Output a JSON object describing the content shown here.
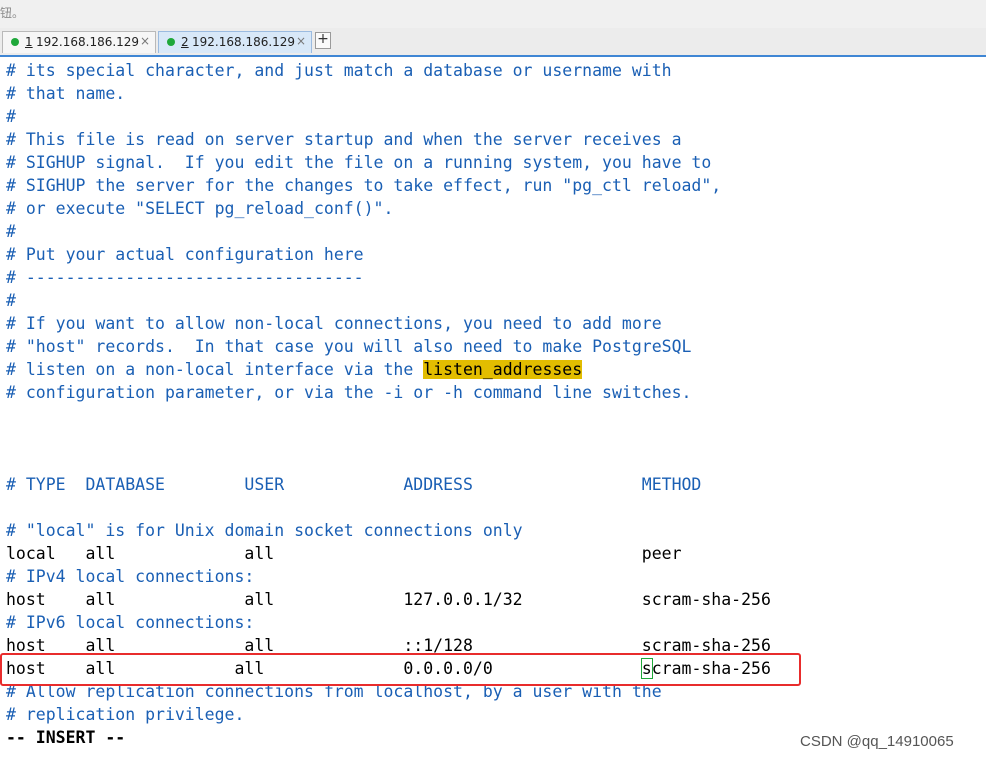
{
  "topstrip_text": "钮。",
  "tabs": [
    {
      "num": "1",
      "host": " 192.168.186.129",
      "close": "×",
      "active": false
    },
    {
      "num": "2",
      "host": " 192.168.186.129",
      "close": "×",
      "active": true
    }
  ],
  "new_tab_symbol": "+",
  "lines": [
    "# its special character, and just match a database or username with",
    "# that name.",
    "#",
    "# This file is read on server startup and when the server receives a",
    "# SIGHUP signal.  If you edit the file on a running system, you have to",
    "# SIGHUP the server for the changes to take effect, run \"pg_ctl reload\",",
    "# or execute \"SELECT pg_reload_conf()\".",
    "#",
    "# Put your actual configuration here",
    "# ----------------------------------",
    "#",
    "# If you want to allow non-local connections, you need to add more",
    "# \"host\" records.  In that case you will also need to make PostgreSQL",
    "# listen on a non-local interface via the ",
    "# configuration parameter, or via the -i or -h command line switches.",
    "",
    "",
    "",
    "# TYPE  DATABASE        USER            ADDRESS                 METHOD",
    "",
    "# \"local\" is for Unix domain socket connections only",
    "local   all             all                                     peer",
    "# IPv4 local connections:",
    "host    all             all             127.0.0.1/32            scram-sha-256",
    "# IPv6 local connections:",
    "host    all             all             ::1/128                 scram-sha-256",
    "host    all            all              0.0.0.0/0               ",
    "# Allow replication connections from localhost, by a user with the",
    "# replication privilege.",
    "-- INSERT --"
  ],
  "highlight_word": "listen_addresses",
  "cursor_char": "s",
  "cursor_rest": "cram-sha-256",
  "watermark": "CSDN @qq_14910065"
}
